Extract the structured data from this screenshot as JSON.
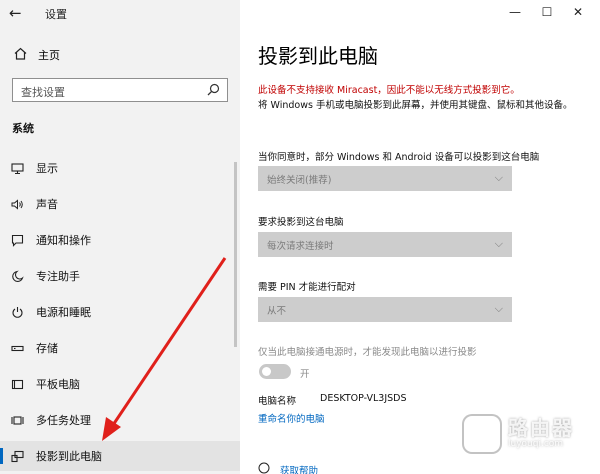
{
  "window": {
    "title": "设置",
    "minimize": "—",
    "maximize": "☐",
    "close": "✕"
  },
  "sidebar": {
    "home_label": "主页",
    "search_placeholder": "查找设置",
    "section_title": "系统",
    "items": [
      {
        "label": "显示",
        "icon": "display-icon"
      },
      {
        "label": "声音",
        "icon": "sound-icon"
      },
      {
        "label": "通知和操作",
        "icon": "notification-icon"
      },
      {
        "label": "专注助手",
        "icon": "focus-assist-icon"
      },
      {
        "label": "电源和睡眠",
        "icon": "power-icon"
      },
      {
        "label": "存储",
        "icon": "storage-icon"
      },
      {
        "label": "平板电脑",
        "icon": "tablet-icon"
      },
      {
        "label": "多任务处理",
        "icon": "multitasking-icon"
      },
      {
        "label": "投影到此电脑",
        "icon": "project-icon",
        "active": true
      }
    ]
  },
  "main": {
    "title": "投影到此电脑",
    "warning": "此设备不支持接收 Miracast，因此不能以无线方式投影到它。",
    "description": "将 Windows 手机或电脑投影到此屏幕，并使用其键盘、鼠标和其他设备。",
    "settings": [
      {
        "label": "当你同意时，部分 Windows 和 Android 设备可以投影到这台电脑",
        "value": "始终关闭(推荐)"
      },
      {
        "label": "要求投影到这台电脑",
        "value": "每次请求连接时"
      },
      {
        "label": "需要 PIN 才能进行配对",
        "value": "从不"
      }
    ],
    "power_hint": "仅当此电脑接通电源时，才能发现此电脑以进行投影",
    "toggle_label": "开",
    "pc_name_label": "电脑名称",
    "pc_name_value": "DESKTOP-VL3JSDS",
    "rename_link": "重命名你的电脑",
    "help_link": "获取帮助"
  },
  "watermark": {
    "name": "路由器",
    "site": "luyouqi.com"
  },
  "colors": {
    "accent": "#0067c0",
    "warning": "#c00000",
    "annotation_arrow": "#e0201b"
  }
}
